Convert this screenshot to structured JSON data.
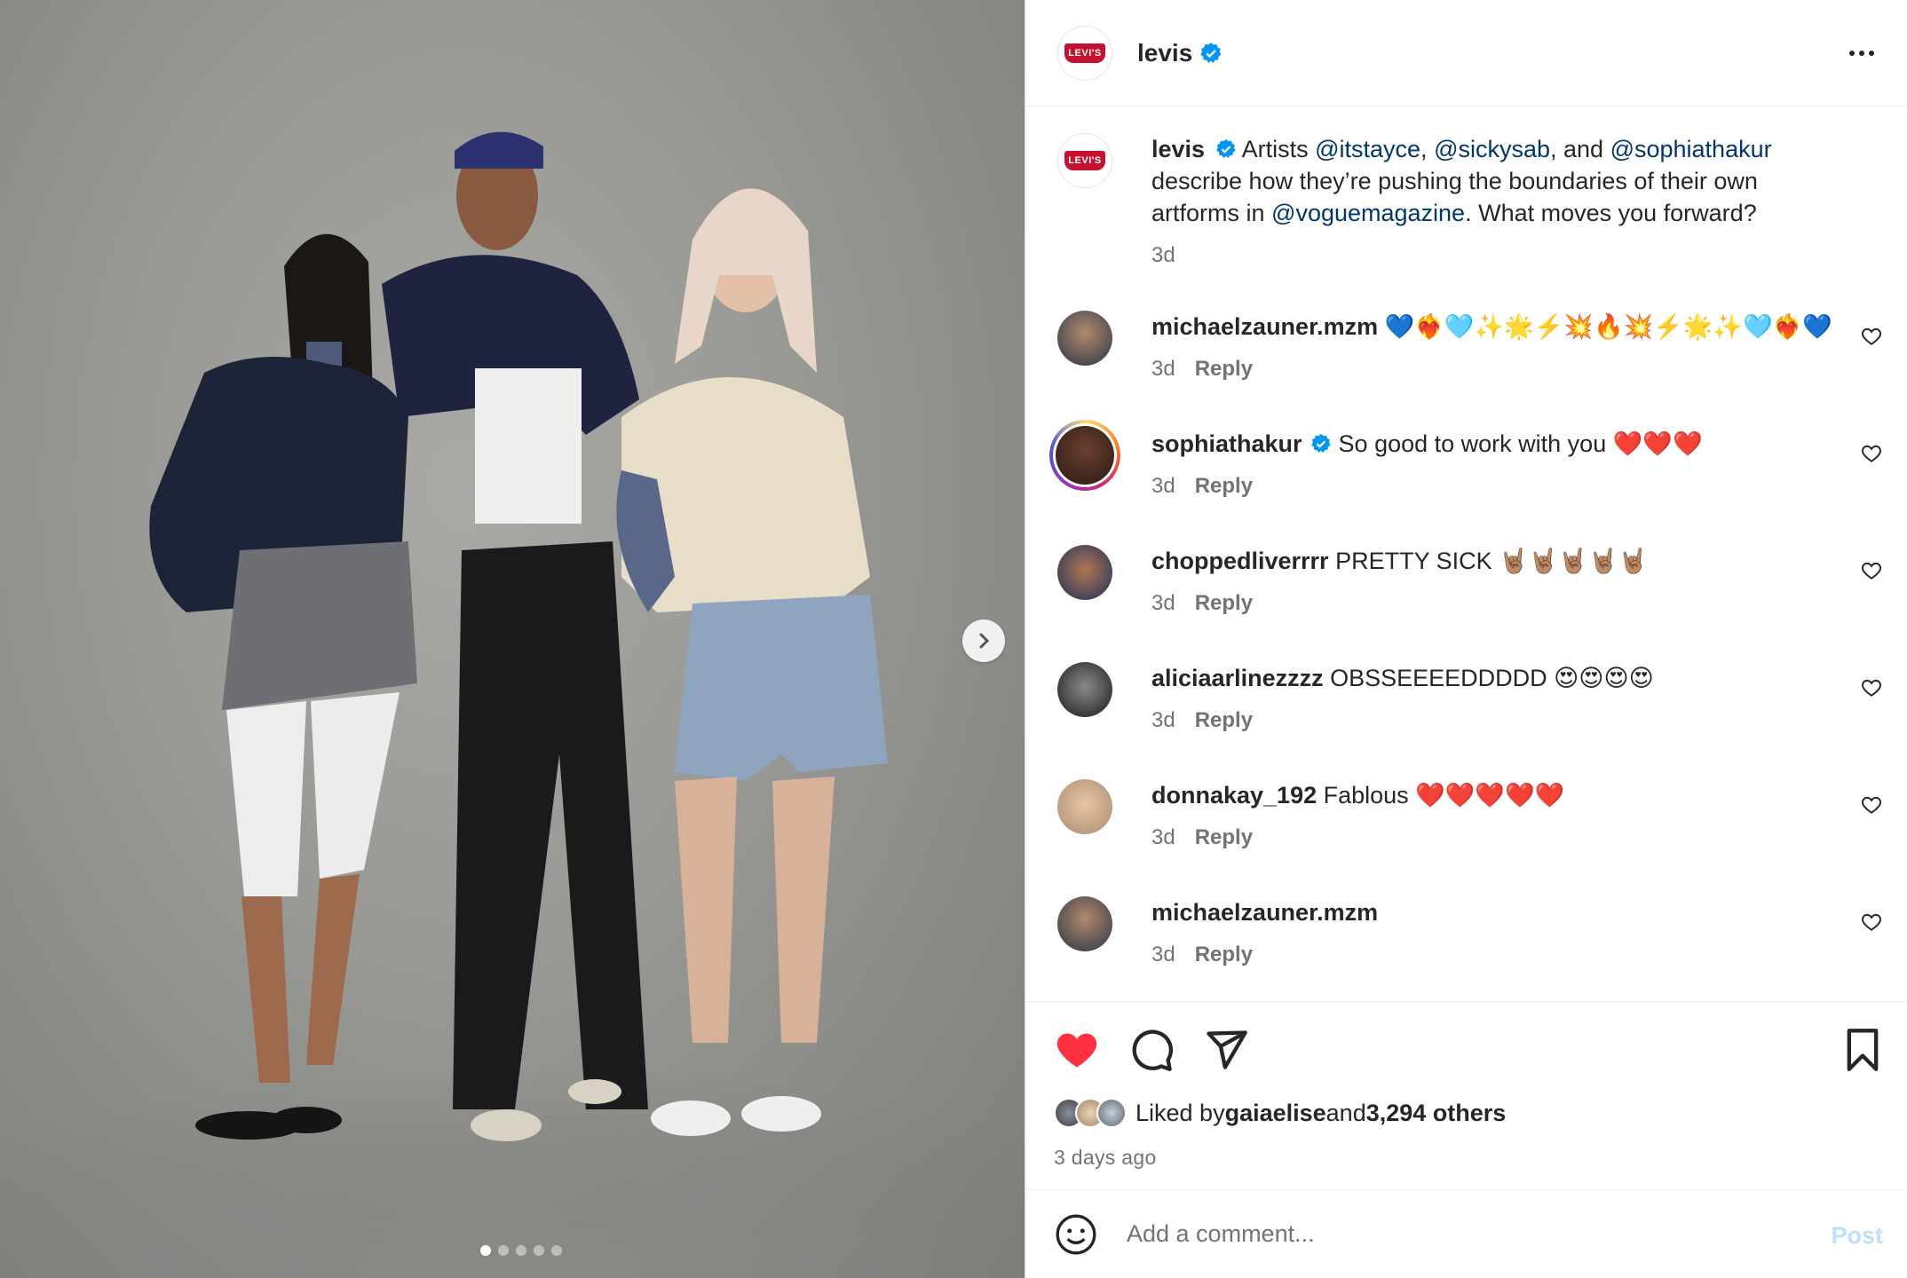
{
  "post": {
    "username": "levis",
    "logo_text": "LEVI'S",
    "caption": {
      "username": "levis",
      "part1": " Artists ",
      "mention1": "@itstayce",
      "sep1": ", ",
      "mention2": "@sickysab",
      "sep2": ", and ",
      "mention3": "@sophiathakur",
      "part2": " describe how they’re pushing the boundaries of their own artforms in ",
      "mention4": "@voguemagazine",
      "part3": ". What moves you forward?",
      "time": "3d"
    },
    "reply_label": "Reply",
    "comments": [
      {
        "username": "michaelzauner.mzm",
        "text": " 💙❤️‍🔥🩵✨🌟⚡️💥🔥💥⚡️🌟✨🩵❤️‍🔥💙",
        "time": "3d",
        "verified": false
      },
      {
        "username": "sophiathakur",
        "text": " So good to work with you ❤️❤️❤️",
        "time": "3d",
        "verified": true
      },
      {
        "username": "choppedliverrrr",
        "text": " PRETTY SICK 🤘🏽🤘🏽🤘🏽🤘🏽🤘🏽",
        "time": "3d",
        "verified": false
      },
      {
        "username": "aliciaarlinezzzz",
        "text": " OBSSEEEEDDDDD 😍😍😍😍",
        "time": "3d",
        "verified": false
      },
      {
        "username": "donnakay_192",
        "text": " Fablous ❤️❤️❤️❤️❤️",
        "time": "3d",
        "verified": false
      },
      {
        "username": "michaelzauner.mzm",
        "text": "",
        "time": "3d",
        "verified": false
      }
    ],
    "likes": {
      "prefix": "Liked by ",
      "user": "gaiaelise",
      "middle": " and ",
      "count": "3,294 others"
    },
    "posted_ago": "3 days ago",
    "add_comment_placeholder": "Add a comment...",
    "post_label": "Post",
    "carousel": {
      "total": 5,
      "active": 1
    }
  },
  "colors": {
    "like_red": "#ff3040",
    "verified_blue": "#0095f6",
    "mention_blue": "#00376b",
    "levis_red": "#c41230",
    "post_disabled": "#c0dffd"
  },
  "icons": [
    "verified-icon",
    "more-icon",
    "heart-icon",
    "comment-icon",
    "share-icon",
    "bookmark-icon",
    "emoji-icon",
    "chevron-right-icon"
  ]
}
